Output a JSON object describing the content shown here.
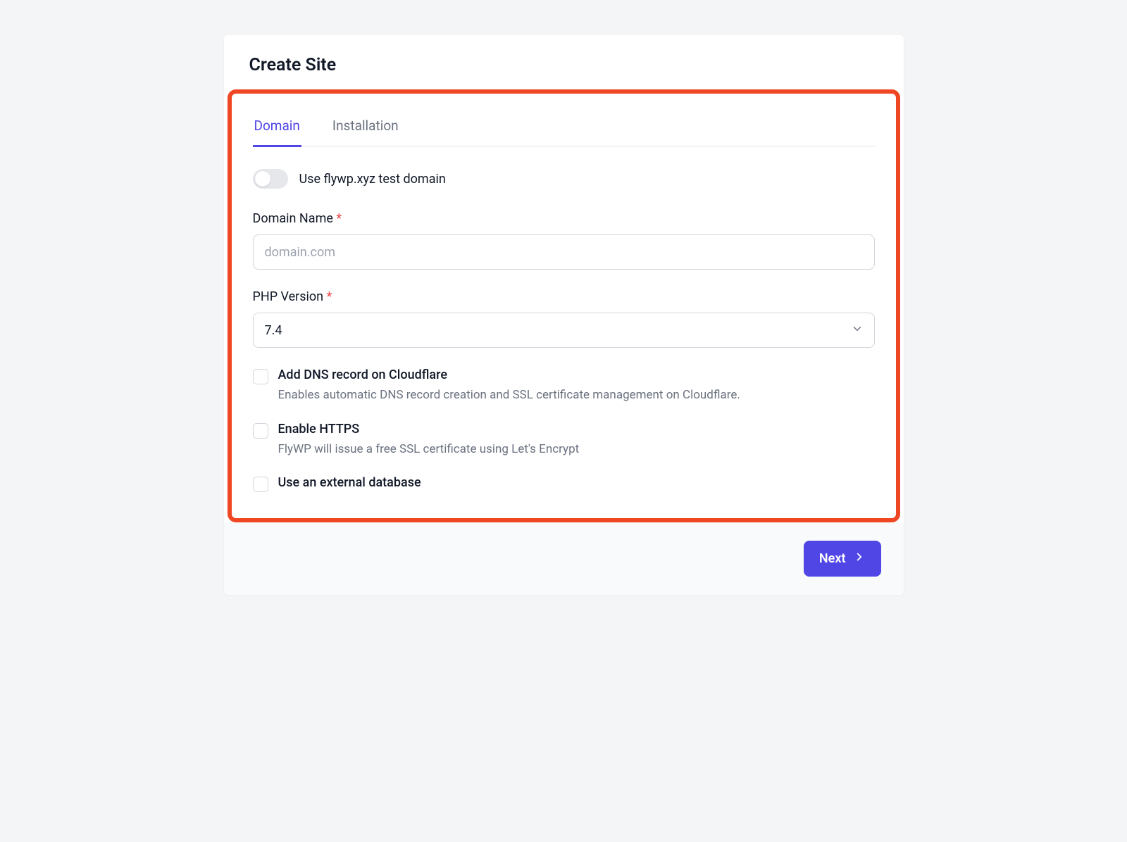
{
  "page_title": "Create Site",
  "tabs": {
    "domain": "Domain",
    "installation": "Installation"
  },
  "toggle": {
    "label": "Use flywp.xyz test domain"
  },
  "domain_field": {
    "label": "Domain Name",
    "required_marker": "*",
    "placeholder": "domain.com",
    "value": ""
  },
  "php_field": {
    "label": "PHP Version",
    "required_marker": "*",
    "value": "7.4"
  },
  "options": {
    "cloudflare": {
      "title": "Add DNS record on Cloudflare",
      "desc": "Enables automatic DNS record creation and SSL certificate management on Cloudflare."
    },
    "https": {
      "title": "Enable HTTPS",
      "desc": "FlyWP will issue a free SSL certificate using Let's Encrypt"
    },
    "external_db": {
      "title": "Use an external database"
    }
  },
  "footer": {
    "next": "Next"
  }
}
